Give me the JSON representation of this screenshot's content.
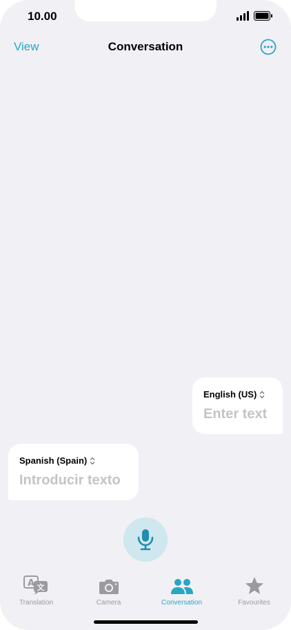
{
  "status_bar": {
    "time": "10.00"
  },
  "nav": {
    "left_label": "View",
    "title": "Conversation"
  },
  "bubbles": {
    "right": {
      "language": "English (US)",
      "placeholder": "Enter text"
    },
    "left": {
      "language": "Spanish (Spain)",
      "placeholder": "Introducir texto"
    }
  },
  "tabs": [
    {
      "label": "Translation",
      "icon": "translate-icon",
      "active": false
    },
    {
      "label": "Camera",
      "icon": "camera-icon",
      "active": false
    },
    {
      "label": "Conversation",
      "icon": "people-icon",
      "active": true
    },
    {
      "label": "Favourites",
      "icon": "star-icon",
      "active": false
    }
  ],
  "colors": {
    "accent": "#27a6c6",
    "background": "#f1f0f5",
    "inactive": "#9a9a9f",
    "mic_bg": "#cfe7ee"
  }
}
